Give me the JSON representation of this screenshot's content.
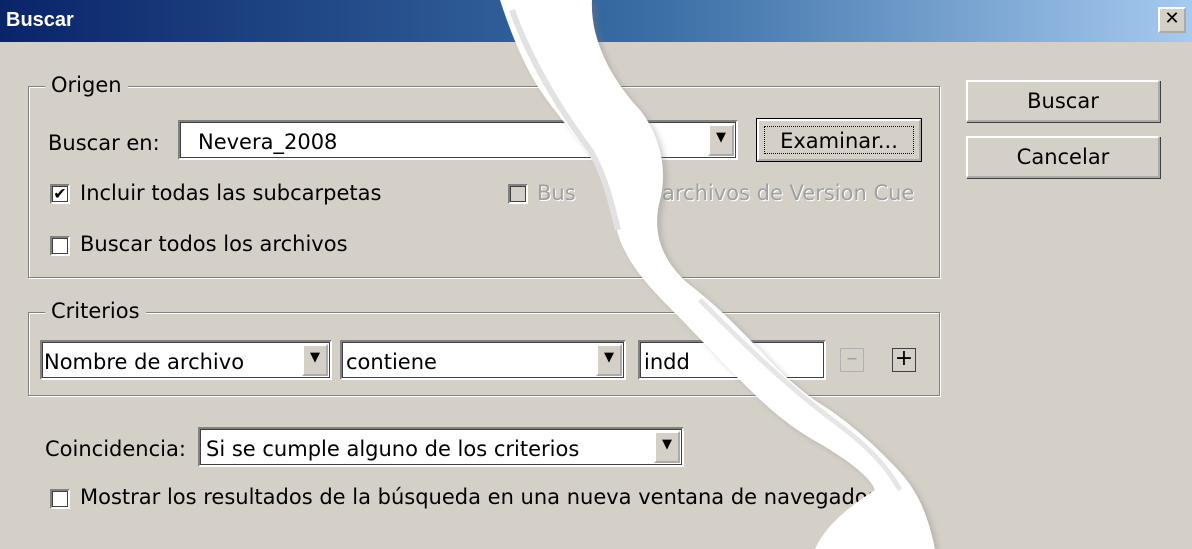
{
  "window": {
    "title": "Buscar",
    "close_symbol": "✕"
  },
  "origin": {
    "legend": "Origen",
    "look_in_label": "Buscar en:",
    "look_in_value": "Nevera_2008",
    "browse_button": "Examinar...",
    "include_subfolders_label": "Incluir todas las subcarpetas",
    "include_subfolders_checked": true,
    "search_all_files_label": "Buscar todos los archivos",
    "search_all_files_checked": false,
    "version_cue_label_left": "Bus",
    "version_cue_label_right": "archivos de Version Cue",
    "version_cue_enabled": false
  },
  "criteria": {
    "legend": "Criterios",
    "field": "Nombre de archivo",
    "operator": "contiene",
    "value": "indd",
    "remove_symbol": "–",
    "add_symbol": "+"
  },
  "match": {
    "label": "Coincidencia:",
    "value": "Si se cumple alguno de los criterios"
  },
  "show_results_label": "Mostrar los resultados de la búsqueda en una nueva ventana de navegador",
  "show_results_checked": false,
  "buttons": {
    "search": "Buscar",
    "cancel": "Cancelar"
  },
  "icons": {
    "dropdown": "▼",
    "check": "✔"
  }
}
